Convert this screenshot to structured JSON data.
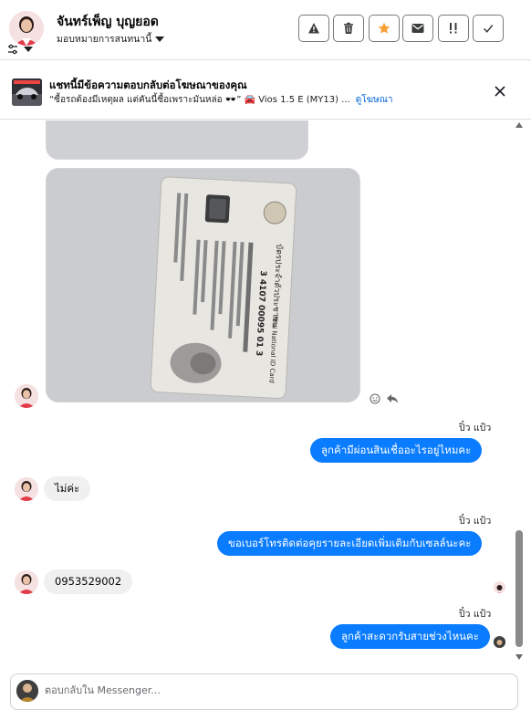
{
  "header": {
    "contact_name": "จันทร์เพ็ญ บุญยอด",
    "assign_label": "มอบหมายการสนทนานี้",
    "toolbar_icons": [
      "warning-icon",
      "trash-icon",
      "star-icon",
      "mail-icon",
      "follow-up-icon",
      "check-icon"
    ]
  },
  "ad_banner": {
    "title": "แชทนี้มีข้อความตอบกลับต่อโฆษณาของคุณ",
    "quote": "“ซื้อรถต้องมีเหตุผล แต่คันนี้ซื้อเพราะมันหล่อ 🕶️” 🚘 Vios 1.5 E (MY13) ...",
    "link_label": "ดูโฆษณา"
  },
  "id_card": {
    "title_th": "บัตรประจำตัวประชาชน",
    "title_en": "Thai National ID Card",
    "id_number": "3 4107 00095 01 3"
  },
  "messages": [
    {
      "side": "out",
      "sender": "ปิ๋ว แป้ว",
      "text": "ลูกค้ามีผ่อนสินเชื่ออะไรอยู่ไหมคะ"
    },
    {
      "side": "in",
      "text": "ไม่ค่ะ"
    },
    {
      "side": "out",
      "sender": "ปิ๋ว แป้ว",
      "text": "ขอเบอร์โทรติดต่อคุยรายละเอียดเพิ่มเติมกับเซลล์นะคะ"
    },
    {
      "side": "in",
      "text": "0953529002"
    },
    {
      "side": "out",
      "sender": "ปิ๋ว แป้ว",
      "text": "ลูกค้าสะดวกรับสายช่วงไหนคะ"
    }
  ],
  "composer": {
    "placeholder": "ตอบกลับใน Messenger..."
  },
  "colors": {
    "accent": "#0a7cff",
    "link": "#0064d1",
    "star": "#f7a134",
    "incoming_bubble": "#f0f0f0"
  }
}
